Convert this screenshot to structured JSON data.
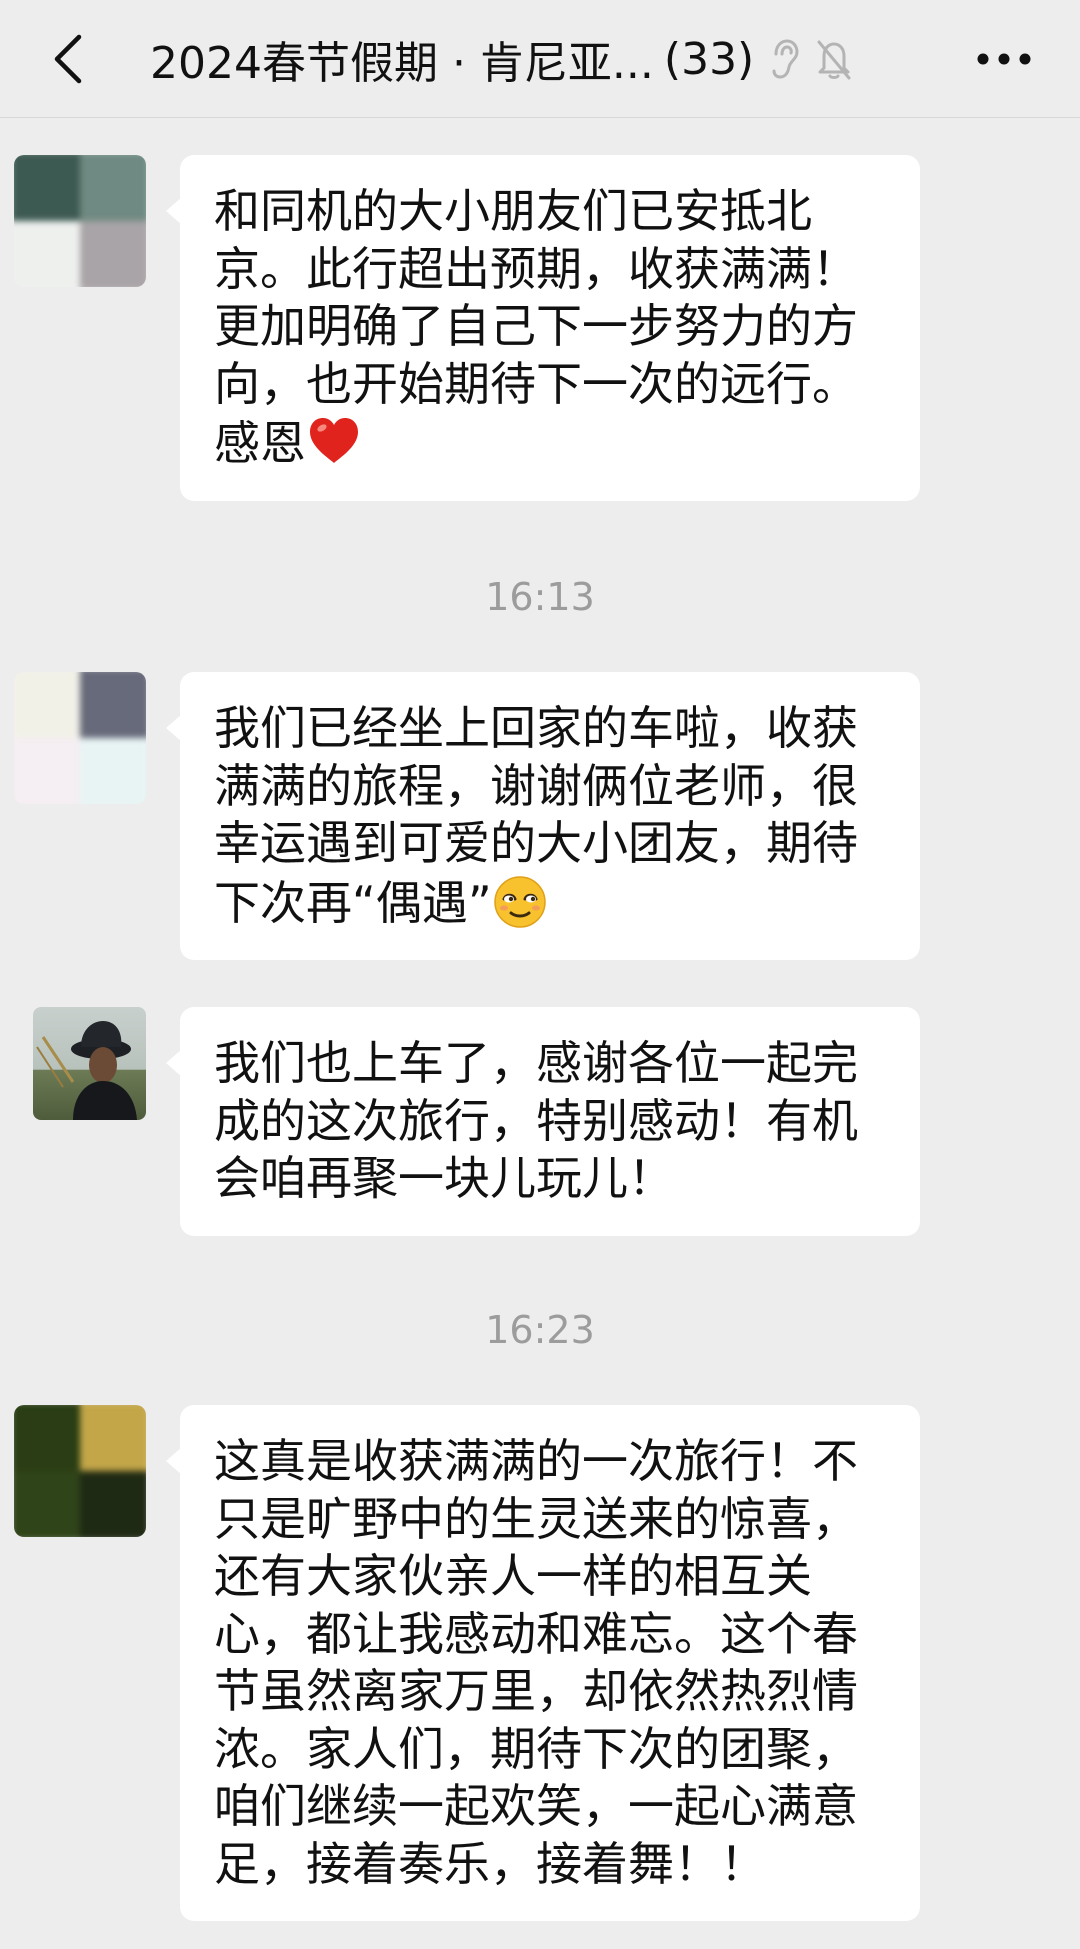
{
  "header": {
    "back_icon": "chevron-left-icon",
    "title": "2024春节假期 · 肯尼亚...",
    "member_count": "(33)",
    "ear_icon": "ear-icon",
    "mute_icon": "bell-muted-icon",
    "more_icon": "more-horizontal-icon"
  },
  "messages": [
    {
      "type": "text",
      "text": "和同机的大小朋友们已安抵北京。此行超出预期，收获满满！更加明确了自己下一步努力的方向，也开始期待下一次的远行。感恩",
      "emoji": "red-heart-emoji"
    },
    {
      "type": "time",
      "text": "16:13"
    },
    {
      "type": "text",
      "text": "我们已经坐上回家的车啦，收获满满的旅程，谢谢俩位老师，很幸运遇到可爱的大小团友，期待下次再“偶遇”",
      "emoji": "relieved-face-emoji"
    },
    {
      "type": "text",
      "text": "我们也上车了，感谢各位一起完成的这次旅行，特别感动！有机会咱再聚一块儿玩儿！"
    },
    {
      "type": "time",
      "text": "16:23"
    },
    {
      "type": "text",
      "text": "这真是收获满满的一次旅行！不只是旷野中的生灵送来的惊喜，还有大家伙亲人一样的相互关心，都让我感动和难忘。这个春节虽然离家万里，却依然热烈情浓。家人们，期待下次的团聚，咱们继续一起欢笑，一起心满意足，接着奏乐，接着舞！！"
    }
  ],
  "colors": {
    "background": "#ededed",
    "bubble": "#ffffff",
    "timestamp": "#9c9c9c",
    "text": "#111111"
  }
}
